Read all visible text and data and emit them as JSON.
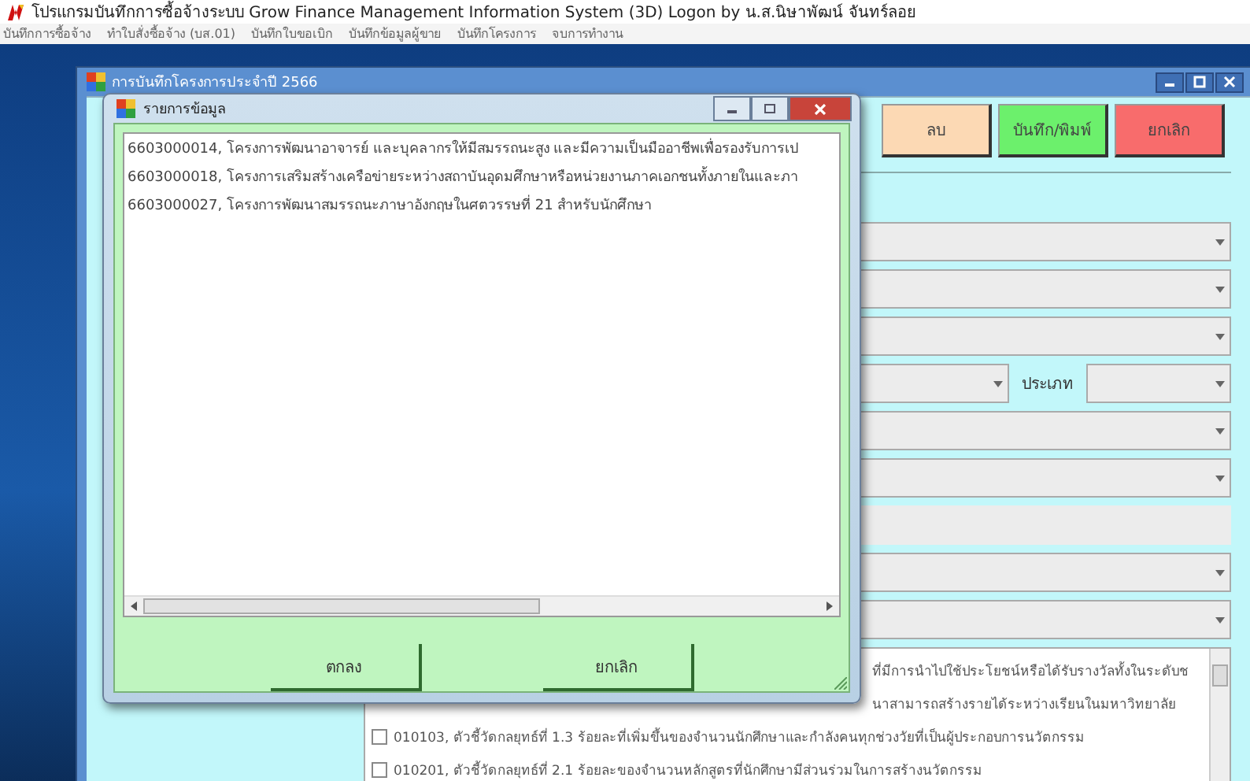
{
  "app_title": "โปรแกรมบันทึกการซื้อจ้างระบบ Grow Finance Management Information System (3D) Logon by น.ส.นิษาพัฒน์ จันทร์ลอย",
  "menu": [
    "บันทึกการซื้อจ้าง",
    "ทำใบสั่งซื้อจ้าง (บส.01)",
    "บันทึกใบขอเบิก",
    "บันทึกข้อมูลผู้ขาย",
    "บันทึกโครงการ",
    "จบการทำงาน"
  ],
  "window": {
    "title": "การบันทึกโครงการประจำปี 2566"
  },
  "toolbar_buttons": [
    {
      "kind": "button",
      "label": "ลบ",
      "color": "#fcd9b4"
    },
    {
      "kind": "button",
      "label": "บันทึก/พิมพ์",
      "color": "#6cf06c"
    },
    {
      "kind": "button",
      "label": "ยกเลิก",
      "color": "#f86c6c"
    }
  ],
  "form_rows": [
    {
      "kind": "combo"
    },
    {
      "kind": "combo"
    },
    {
      "kind": "combo"
    },
    {
      "kind": "combo_pair",
      "label": "ประเภท"
    },
    {
      "kind": "combo"
    },
    {
      "kind": "combo"
    },
    {
      "kind": "text"
    },
    {
      "kind": "combo"
    },
    {
      "kind": "combo"
    }
  ],
  "checklist": [
    {
      "kind": "covered",
      "text": "ที่มีการนำไปใช้ประโยชน์หรือได้รับรางวัลทั้งในระดับช"
    },
    {
      "kind": "covered",
      "text": "นาสามารถสร้างรายได้ระหว่างเรียนในมหาวิทยาลัย"
    },
    {
      "kind": "item",
      "text": "010103, ตัวชี้วัดกลยุทธ์ที่ 1.3 ร้อยละที่เพิ่มขึ้นของจำนวนนักศึกษาและกำลังคนทุกช่วงวัยที่เป็นผู้ประกอบการนวัตกรรม",
      "checked": false
    },
    {
      "kind": "item",
      "text": "010201, ตัวชี้วัดกลยุทธ์ที่ 2.1 ร้อยละของจำนวนหลักสูตรที่นักศึกษามีส่วนร่วมในการสร้างนวัตกรรม",
      "checked": false
    }
  ],
  "dialog": {
    "title": "รายการข้อมูล",
    "items": [
      "6603000014, โครงการพัฒนาอาจารย์ และบุคลากรให้มีสมรรถนะสูง และมีความเป็นมืออาชีพเพื่อรองรับการเป",
      "6603000018, โครงการเสริมสร้างเครือข่ายระหว่างสถาบันอุดมศึกษาหรือหน่วยงานภาคเอกชนทั้งภายในและภา",
      "6603000027, โครงการพัฒนาสมรรถนะภาษาอังกฤษในศตวรรษที่ 21 สำหรับนักศึกษา"
    ],
    "buttons": [
      "ตกลง",
      "ยกเลิก"
    ]
  }
}
